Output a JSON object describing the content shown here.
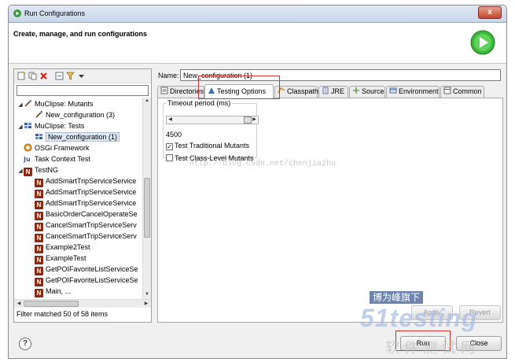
{
  "window": {
    "title": "Run Configurations",
    "close_glyph": "x"
  },
  "banner": {
    "text": "Create, manage, and run configurations"
  },
  "left": {
    "toolbar_icons": [
      "new-launch-config-icon",
      "duplicate-icon",
      "delete-icon",
      "collapse-all-icon",
      "filter-icon",
      "view-menu-icon"
    ],
    "filter_value": "",
    "tree": [
      {
        "label": "MuClipse: Mutants",
        "icon": "mutant-wand-icon",
        "level": 0,
        "expanded": true
      },
      {
        "label": "New_configuration (3)",
        "icon": "mutant-wand-icon",
        "level": 1
      },
      {
        "label": "MuClipse: Tests",
        "icon": "tests-grid-icon",
        "level": 0,
        "expanded": true
      },
      {
        "label": "New_configuration (1)",
        "icon": "tests-grid-icon",
        "level": 1,
        "selected": true
      },
      {
        "label": "OSGi Framework",
        "icon": "osgi-icon",
        "level": 0
      },
      {
        "label": "Task Context Test",
        "icon": "ju-icon",
        "level": 0
      },
      {
        "label": "TestNG",
        "icon": "testng-icon",
        "level": 0,
        "expanded": true
      },
      {
        "label": "AddSmartTripServiceService",
        "icon": "testng-icon",
        "level": 1
      },
      {
        "label": "AddSmartTripServiceService",
        "icon": "testng-icon",
        "level": 1
      },
      {
        "label": "AddSmartTripServiceService",
        "icon": "testng-icon",
        "level": 1
      },
      {
        "label": "BasicOrderCancelOperateSe",
        "icon": "testng-icon",
        "level": 1
      },
      {
        "label": "CancelSmartTripServiceServ",
        "icon": "testng-icon",
        "level": 1
      },
      {
        "label": "CancelSmartTripServiceServ",
        "icon": "testng-icon",
        "level": 1
      },
      {
        "label": "Example2Test",
        "icon": "testng-icon",
        "level": 1
      },
      {
        "label": "ExampleTest",
        "icon": "testng-icon",
        "level": 1
      },
      {
        "label": "GetPOIFavoriteListServiceSe",
        "icon": "testng-icon",
        "level": 1
      },
      {
        "label": "GetPOIFavoriteListServiceSe",
        "icon": "testng-icon",
        "level": 1
      },
      {
        "label": "Main, ...",
        "icon": "testng-icon",
        "level": 1
      }
    ],
    "status": "Filter matched 50 of 58 items"
  },
  "right": {
    "name_label": "Name:",
    "name_value": "New_configuration (1)",
    "tabs": [
      {
        "label": "Directories",
        "icon": "directories-icon"
      },
      {
        "label": "Testing Options",
        "icon": "testing-options-icon",
        "active": true
      },
      {
        "label": "Classpath",
        "icon": "classpath-icon"
      },
      {
        "label": "JRE",
        "icon": "jre-icon"
      },
      {
        "label": "Source",
        "icon": "source-icon"
      },
      {
        "label": "Environment",
        "icon": "environment-icon"
      },
      {
        "label": "Common",
        "icon": "common-icon"
      }
    ],
    "timeout_group_title": "Timeout period (ms)",
    "timeout_value": "4500",
    "checks": [
      {
        "label": "Test Traditional Mutants",
        "checked": true
      },
      {
        "label": "Test Class-Level Mutants",
        "checked": false
      }
    ],
    "watermark": "http://blog.csdn.net/chenjiazhu"
  },
  "buttons": {
    "apply": "Apply",
    "revert": "Revert",
    "run": "Run",
    "close": "Close",
    "help": "?"
  },
  "logo": {
    "top": "博为峰旗下",
    "mid": "51testing",
    "bottom": "软件测试网"
  },
  "colors": {
    "selection": "#dde9f8",
    "highlight_box": "#d03030",
    "titlebar": "#c8d6e8"
  }
}
